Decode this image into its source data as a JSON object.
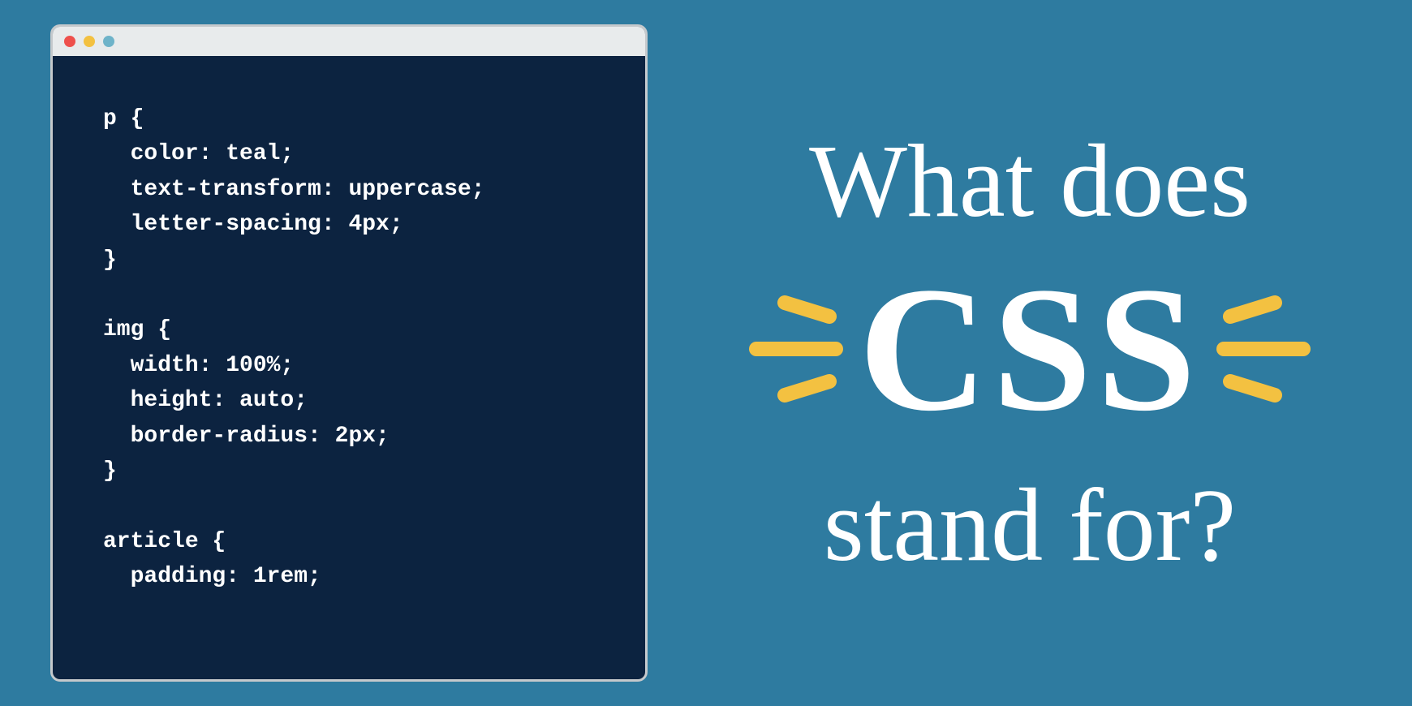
{
  "window": {
    "traffic_lights": [
      "red",
      "yellow",
      "blue"
    ]
  },
  "code": {
    "lines": [
      "p {",
      "  color: teal;",
      "  text-transform: uppercase;",
      "  letter-spacing: 4px;",
      "}",
      "",
      "img {",
      "  width: 100%;",
      "  height: auto;",
      "  border-radius: 2px;",
      "}",
      "",
      "article {",
      "  padding: 1rem;"
    ]
  },
  "headline": {
    "line1": "What does",
    "css": "CSS",
    "line2": "stand for?"
  }
}
